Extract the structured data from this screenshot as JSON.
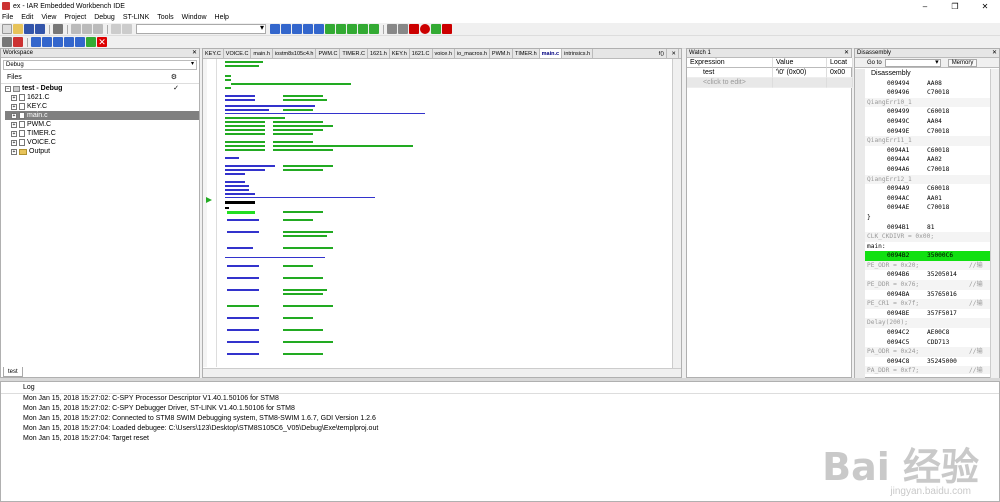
{
  "window": {
    "title": "ex - IAR Embedded Workbench IDE",
    "min": "–",
    "restore": "❐",
    "close": "✕"
  },
  "menu": [
    "File",
    "Edit",
    "View",
    "Project",
    "Debug",
    "ST-LINK",
    "Tools",
    "Window",
    "Help"
  ],
  "workspace": {
    "title": "Workspace",
    "config": "Debug",
    "files_label": "Files",
    "project": "test - Debug",
    "items": [
      "1621.C",
      "KEY.C",
      "main.c",
      "PWM.C",
      "TIMER.C",
      "VOICE.C",
      "Output"
    ],
    "tab": "test"
  },
  "editor": {
    "tabs": [
      "KEY.C",
      "VOICE.C",
      "main.h",
      "iostm8s105c4.h",
      "PWM.C",
      "TIMER.C",
      "1621.h",
      "KEY.h",
      "1621.C",
      "voice.h",
      "io_macros.h",
      "PWM.h",
      "TIMER.h",
      "main.c",
      "intrinsics.h"
    ],
    "active": "main.c",
    "func": "f()"
  },
  "watch": {
    "title": "Watch 1",
    "headers": [
      "Expression",
      "Value",
      "Locat"
    ],
    "rows": [
      [
        "test",
        "'\\0' (0x00)",
        "0x00"
      ]
    ],
    "placeholder": "<click to edit>"
  },
  "disassembly": {
    "title": "Disassembly",
    "goto": "Go to",
    "memory": "Memory",
    "header": "Disassembly",
    "rows": [
      {
        "t": "code",
        "a": "009494",
        "v": "AA08"
      },
      {
        "t": "code",
        "a": "009496",
        "v": "C70018"
      },
      {
        "t": "lab",
        "a": "QiangErr10_1",
        "v": ""
      },
      {
        "t": "code",
        "a": "009499",
        "v": "C60018"
      },
      {
        "t": "code",
        "a": "00949C",
        "v": "AA04"
      },
      {
        "t": "code",
        "a": "00949E",
        "v": "C70018"
      },
      {
        "t": "lab",
        "a": "QiangErr11_1",
        "v": ""
      },
      {
        "t": "code",
        "a": "0094A1",
        "v": "C60018"
      },
      {
        "t": "code",
        "a": "0094A4",
        "v": "AA02"
      },
      {
        "t": "code",
        "a": "0094A6",
        "v": "C70018"
      },
      {
        "t": "lab",
        "a": "QiangErr12_1",
        "v": ""
      },
      {
        "t": "code",
        "a": "0094A9",
        "v": "C60018"
      },
      {
        "t": "code",
        "a": "0094AC",
        "v": "AA01"
      },
      {
        "t": "code",
        "a": "0094AE",
        "v": "C70018"
      },
      {
        "t": "plain",
        "a": "}",
        "v": ""
      },
      {
        "t": "code",
        "a": "0094B1",
        "v": "81"
      },
      {
        "t": "lab",
        "a": "CLK_CKDIVR = 0x00;",
        "v": ""
      },
      {
        "t": "plain",
        "a": "main:",
        "v": ""
      },
      {
        "t": "cur",
        "a": "0094B2",
        "v": "35000C6"
      },
      {
        "t": "lab",
        "a": "PE_ODR = 0x20;",
        "v": "//输"
      },
      {
        "t": "code",
        "a": "0094B6",
        "v": "35205014"
      },
      {
        "t": "lab",
        "a": "PE_DDR = 0x76;",
        "v": "//输"
      },
      {
        "t": "code",
        "a": "0094BA",
        "v": "35765016"
      },
      {
        "t": "lab",
        "a": "PE_CR1 = 0x7f;",
        "v": "//输"
      },
      {
        "t": "code",
        "a": "0094BE",
        "v": "357F5017"
      },
      {
        "t": "lab",
        "a": "Delay(200);",
        "v": ""
      },
      {
        "t": "code",
        "a": "0094C2",
        "v": "AE00C8"
      },
      {
        "t": "code",
        "a": "0094C5",
        "v": "CDD713"
      },
      {
        "t": "lab",
        "a": "PA_ODR = 0x24;",
        "v": "//输"
      },
      {
        "t": "code",
        "a": "0094C8",
        "v": "35245000"
      },
      {
        "t": "lab",
        "a": "PA_DDR = 0xf7;",
        "v": "//输"
      },
      {
        "t": "code",
        "a": "0094CC",
        "v": "35F75002"
      }
    ]
  },
  "log": {
    "title": "Log",
    "rows": [
      "Mon Jan 15, 2018 15:27:02: C-SPY Processor Descriptor V1.40.1.50106 for STM8",
      "Mon Jan 15, 2018 15:27:02: C-SPY Debugger Driver, ST-LINK V1.40.1.50106 for STM8",
      "Mon Jan 15, 2018 15:27:02: Connected to STM8 SWIM Debugging system, STM8-SWIM 1.6.7, GDI Version 1.2.6",
      "Mon Jan 15, 2018 15:27:04: Loaded debugee: C:\\Users\\123\\Desktop\\STM8S105C6_V05\\Debug\\Exe\\templproj.out",
      "Mon Jan 15, 2018 15:27:04: Target reset"
    ]
  },
  "watermark": {
    "main": "Bai 经验",
    "sub": "jingyan.baidu.com"
  },
  "colors": {
    "exec": "#11e011",
    "selected_tree": "#808080"
  }
}
